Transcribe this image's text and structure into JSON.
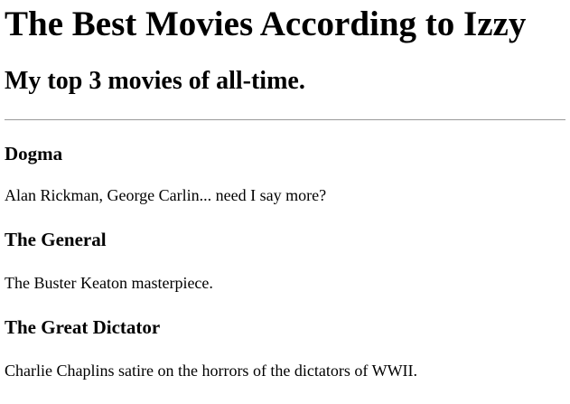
{
  "page": {
    "title": "The Best Movies According to Izzy",
    "subtitle": "My top 3 movies of all-time."
  },
  "movies": [
    {
      "title": "Dogma",
      "description": "Alan Rickman, George Carlin... need I say more?"
    },
    {
      "title": "The General",
      "description": "The Buster Keaton masterpiece."
    },
    {
      "title": "The Great Dictator",
      "description": "Charlie Chaplins satire on the horrors of the dictators of WWII."
    }
  ]
}
